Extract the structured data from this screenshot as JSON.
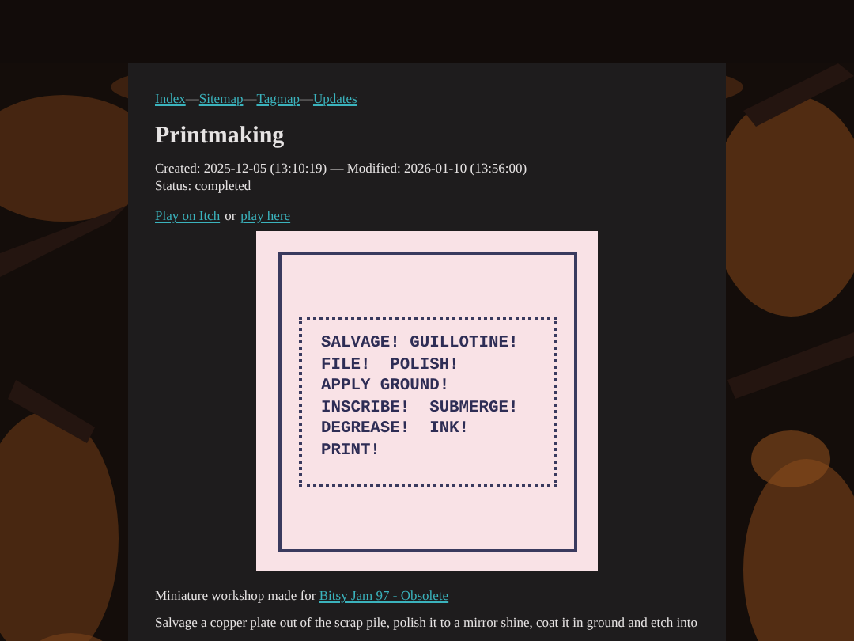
{
  "nav": [
    {
      "label": "Index"
    },
    {
      "label": "Sitemap"
    },
    {
      "label": "Tagmap"
    },
    {
      "label": "Updates"
    }
  ],
  "nav_separator": "—",
  "title": "Printmaking",
  "meta": {
    "dates": "Created: 2025-12-05 (13:10:19) — Modified: 2026-01-10 (13:56:00)",
    "status": "Status: completed"
  },
  "play_links": {
    "first": "Play on Itch",
    "joiner": "or",
    "second": "play here"
  },
  "game_screen": {
    "lines": [
      "SALVAGE! GUILLOTINE!",
      "FILE!  POLISH!",
      "APPLY GROUND!",
      "INSCRIBE!  SUBMERGE!",
      "DEGREASE!  INK!",
      "PRINT!"
    ]
  },
  "intro": {
    "text": "Miniature workshop made for",
    "link": "Bitsy Jam 97 - Obsolete"
  },
  "description": "Salvage a copper plate out of the scrap pile, polish it to a mirror shine, coat it in ground and etch into"
}
